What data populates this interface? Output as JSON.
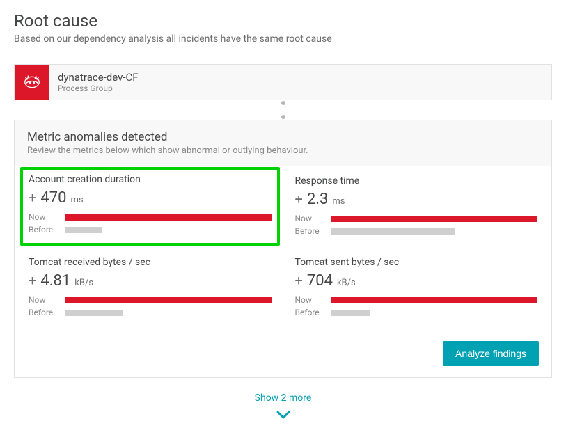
{
  "header": {
    "title": "Root cause",
    "subtitle": "Based on our dependency analysis all incidents have the same root cause"
  },
  "entity": {
    "name": "dynatrace-dev-CF",
    "type": "Process Group"
  },
  "anomalies": {
    "title": "Metric anomalies detected",
    "subtitle": "Review the metrics below which show abnormal or outlying behaviour.",
    "metrics": [
      {
        "title": "Account creation duration",
        "sign": "+",
        "value": "470",
        "unit": "ms",
        "now_label": "Now",
        "before_label": "Before",
        "now_pct": 100,
        "before_pct": 18,
        "highlighted": true
      },
      {
        "title": "Response time",
        "sign": "+",
        "value": "2.3",
        "unit": "ms",
        "now_label": "Now",
        "before_label": "Before",
        "now_pct": 100,
        "before_pct": 60,
        "highlighted": false
      },
      {
        "title": "Tomcat received bytes / sec",
        "sign": "+",
        "value": "4.81",
        "unit": "kB/s",
        "now_label": "Now",
        "before_label": "Before",
        "now_pct": 100,
        "before_pct": 28,
        "highlighted": false
      },
      {
        "title": "Tomcat sent bytes / sec",
        "sign": "+",
        "value": "704",
        "unit": "kB/s",
        "now_label": "Now",
        "before_label": "Before",
        "now_pct": 100,
        "before_pct": 19,
        "highlighted": false
      }
    ],
    "analyze_button": "Analyze findings"
  },
  "show_more": {
    "label": "Show 2 more"
  },
  "colors": {
    "danger": "#dc172a",
    "muted": "#cfcfcf",
    "accent": "#00a1b2",
    "highlight": "#00d100"
  }
}
